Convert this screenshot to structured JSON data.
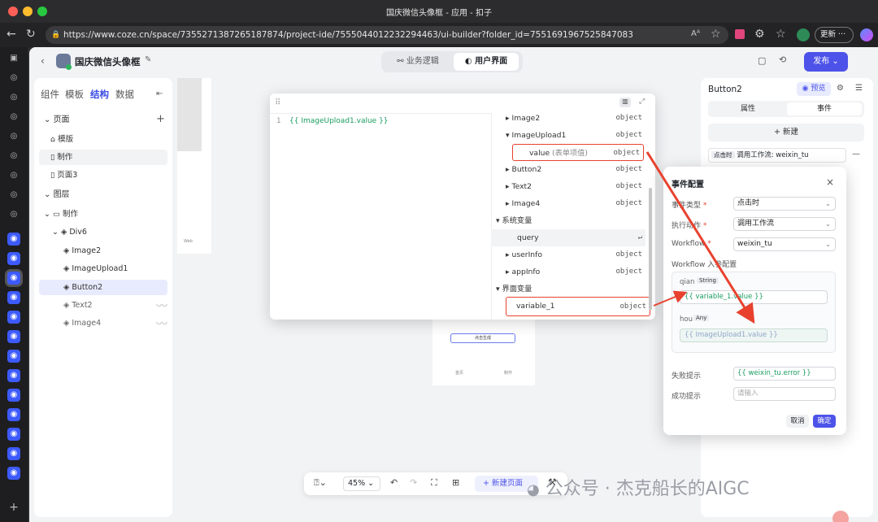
{
  "window": {
    "title": "国庆微信头像框 - 应用 - 扣子"
  },
  "browser": {
    "url": "https://www.coze.cn/space/7355271387265187874/project-ide/7555044012232294463/ui-builder?folder_id=7551691967525847083",
    "update_label": "更新"
  },
  "app": {
    "name": "国庆微信头像框",
    "tab_logic": "业务逻辑",
    "tab_ui": "用户界面",
    "publish": "发布"
  },
  "left": {
    "tabs": [
      "组件",
      "模板",
      "结构",
      "数据"
    ],
    "pages_title": "页面",
    "pages": [
      "模版",
      "制作",
      "页面3"
    ],
    "layers_title": "图层",
    "layers": [
      "制作",
      "Div6",
      "Image2",
      "ImageUpload1",
      "Button2",
      "Text2",
      "Image4"
    ]
  },
  "varpop": {
    "code": "{{ ImageUpload1.value }}",
    "line_no": "1",
    "rows": [
      {
        "name": "Image2",
        "type": "object"
      },
      {
        "name": "ImageUpload1",
        "type": "object"
      },
      {
        "name": "value",
        "sub": "(表单项值)",
        "type": "object"
      },
      {
        "name": "Button2",
        "type": "object"
      },
      {
        "name": "Text2",
        "type": "object"
      },
      {
        "name": "Image4",
        "type": "object"
      }
    ],
    "sys_title": "系统变量",
    "sys_rows": [
      {
        "name": "query",
        "type": "↵"
      },
      {
        "name": "userInfo",
        "type": "object"
      },
      {
        "name": "appInfo",
        "type": "object"
      }
    ],
    "ui_title": "界面变量",
    "ui_rows": [
      {
        "name": "variable_1",
        "type": "object"
      }
    ]
  },
  "phone": {
    "button_text": "点击生成",
    "nav1": "首页",
    "nav2": "制作",
    "left_nav": "Web"
  },
  "right": {
    "component": "Button2",
    "preview": "预览",
    "tab_props": "属性",
    "tab_events": "事件",
    "new_label": "+ 新建",
    "event_tag": "点击时",
    "event_desc": "调用工作流: weixin_tu",
    "remove": "—"
  },
  "dialog": {
    "title": "事件配置",
    "close": "×",
    "event_type_label": "事件类型",
    "event_type_val": "点击时",
    "action_label": "执行动作",
    "action_val": "调用工作流",
    "workflow_label": "Workflow",
    "workflow_val": "weixin_tu",
    "params_label": "Workflow 入参配置",
    "p1_name": "qian",
    "p1_type": "String",
    "p1_val": "{{ variable_1.value }}",
    "p2_name": "hou",
    "p2_type": "Any",
    "p2_val": "{{ ImageUpload1.value }}",
    "fail_label": "失败提示",
    "fail_val": "{{ weixin_tu.error }}",
    "success_label": "成功提示",
    "success_placeholder": "请输入",
    "cancel": "取消",
    "ok": "确定"
  },
  "toolbar": {
    "zoom": "45%",
    "new_page": "新建页面"
  },
  "watermark": "公众号 · 杰克船长的AIGC",
  "colors": {
    "accent": "#3d4ee8",
    "red_box": "#e8422e"
  }
}
